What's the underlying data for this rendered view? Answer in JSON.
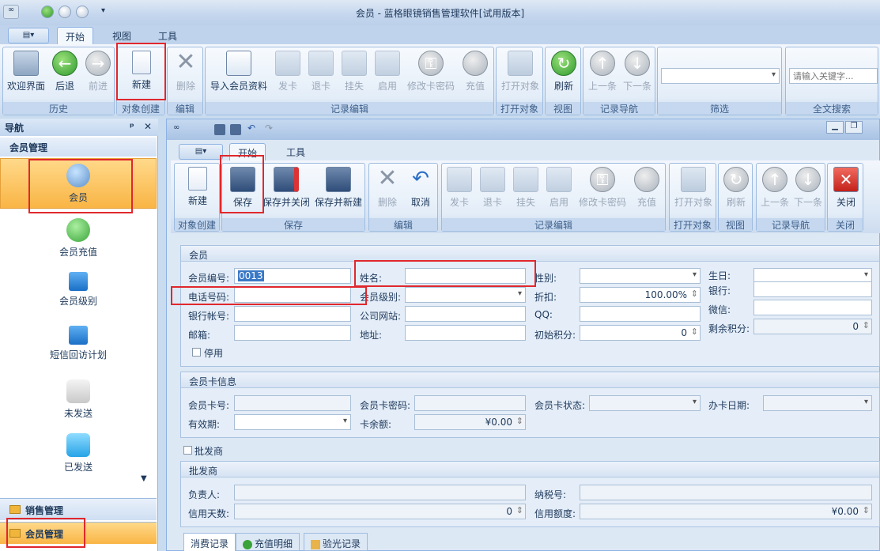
{
  "app": {
    "title": "会员 - 蓝格眼镜销售管理软件[试用版本]"
  },
  "main_tabs": [
    "开始",
    "视图",
    "工具"
  ],
  "ribbon": {
    "buttons": {
      "welcome": "欢迎界面",
      "back": "后退",
      "forward": "前进",
      "new": "新建",
      "delete": "删除",
      "import": "导入会员资料",
      "issue_card": "发卡",
      "return_card": "退卡",
      "report_loss": "挂失",
      "enable": "启用",
      "change_pwd": "修改卡密码",
      "recharge": "充值",
      "open_obj": "打开对象",
      "refresh": "刷新",
      "prev": "上一条",
      "next": "下一条"
    },
    "groups": {
      "history": "历史",
      "create": "对象创建",
      "edit": "编辑",
      "record_edit": "记录编辑",
      "open_obj": "打开对象",
      "view": "视图",
      "record_nav": "记录导航",
      "filter": "筛选",
      "search": "全文搜索"
    },
    "search_placeholder": "请输入关键字..."
  },
  "nav": {
    "title": "导航",
    "pin": "ᵖ",
    "close": "✕",
    "section": "会员管理",
    "items": [
      "会员",
      "会员充值",
      "会员级别",
      "短信回访计划",
      "未发送",
      "已发送"
    ],
    "bottom": [
      "销售管理",
      "会员管理"
    ]
  },
  "child": {
    "tabs": [
      "开始",
      "工具"
    ],
    "buttons": {
      "new": "新建",
      "save": "保存",
      "save_close": "保存并关闭",
      "save_new": "保存并新建",
      "delete": "删除",
      "cancel": "取消",
      "issue_card": "发卡",
      "return_card": "退卡",
      "report_loss": "挂失",
      "enable": "启用",
      "change_pwd": "修改卡密码",
      "recharge": "充值",
      "open_obj": "打开对象",
      "refresh": "刷新",
      "prev": "上一条",
      "next": "下一条",
      "close": "关闭"
    },
    "groups": {
      "create": "对象创建",
      "save": "保存",
      "edit": "编辑",
      "record_edit": "记录编辑",
      "open_obj": "打开对象",
      "view": "视图",
      "record_nav": "记录导航",
      "close": "关闭"
    }
  },
  "member": {
    "section": "会员",
    "labels": {
      "id": "会员编号:",
      "name": "姓名:",
      "gender": "性别:",
      "birthday": "生日:",
      "bank": "银行:",
      "phone": "电话号码:",
      "level": "会员级别:",
      "discount": "折扣:",
      "wechat": "微信:",
      "account": "银行帐号:",
      "website": "公司网站:",
      "qq": "QQ:",
      "remaining": "剩余积分:",
      "email": "邮箱:",
      "address": "地址:",
      "initial": "初始积分:",
      "disabled": "停用"
    },
    "values": {
      "id": "0013",
      "discount": "100.00%",
      "remaining": "0",
      "initial": "0"
    }
  },
  "card": {
    "section": "会员卡信息",
    "labels": {
      "card_no": "会员卡号:",
      "card_pwd": "会员卡密码:",
      "card_status": "会员卡状态:",
      "card_date": "办卡日期:",
      "validity": "有效期:",
      "balance": "卡余额:"
    },
    "values": {
      "balance": "¥0.00"
    }
  },
  "wholesale": {
    "checkbox": "批发商",
    "section": "批发商",
    "labels": {
      "manager": "负责人:",
      "taxno": "纳税号:",
      "credit_days": "信用天数:",
      "credit_limit": "信用额度:"
    },
    "values": {
      "credit_days": "0",
      "credit_limit": "¥0.00"
    }
  },
  "bottom_tabs": [
    "消费记录",
    "充值明细",
    "验光记录"
  ]
}
